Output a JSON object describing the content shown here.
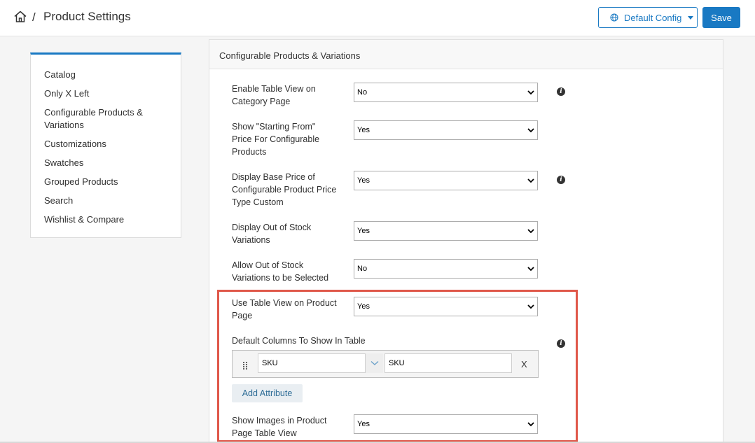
{
  "header": {
    "breadcrumb_separator": "/",
    "title": "Product Settings",
    "config_label": "Default Config",
    "save_label": "Save"
  },
  "sidebar": {
    "items": [
      {
        "label": "Catalog"
      },
      {
        "label": "Only X Left"
      },
      {
        "label": "Configurable Products & Variations"
      },
      {
        "label": "Customizations"
      },
      {
        "label": "Swatches"
      },
      {
        "label": "Grouped Products"
      },
      {
        "label": "Search"
      },
      {
        "label": "Wishlist & Compare"
      }
    ]
  },
  "panel": {
    "title": "Configurable Products & Variations",
    "fields": [
      {
        "label": "Enable Table View on Category Page",
        "value": "No",
        "info": true
      },
      {
        "label": "Show \"Starting From\" Price For Configurable Products",
        "value": "Yes",
        "info": false
      },
      {
        "label": "Display Base Price of Configurable Product Price Type Custom",
        "value": "Yes",
        "info": true
      },
      {
        "label": "Display Out of Stock Variations",
        "value": "Yes",
        "info": false
      },
      {
        "label": "Allow Out of Stock Variations to be Selected",
        "value": "No",
        "info": false
      },
      {
        "label": "Use Table View on Product Page",
        "value": "Yes",
        "info": false
      }
    ],
    "columns": {
      "label": "Default Columns To Show In Table",
      "rows": [
        {
          "attribute": "SKU",
          "title": "SKU",
          "remove": "X"
        }
      ],
      "add_label": "Add Attribute"
    },
    "images_field": {
      "label": "Show Images in Product Page Table View",
      "value": "Yes"
    }
  },
  "colors": {
    "accent": "#1979c3",
    "highlight": "#e0584a"
  }
}
